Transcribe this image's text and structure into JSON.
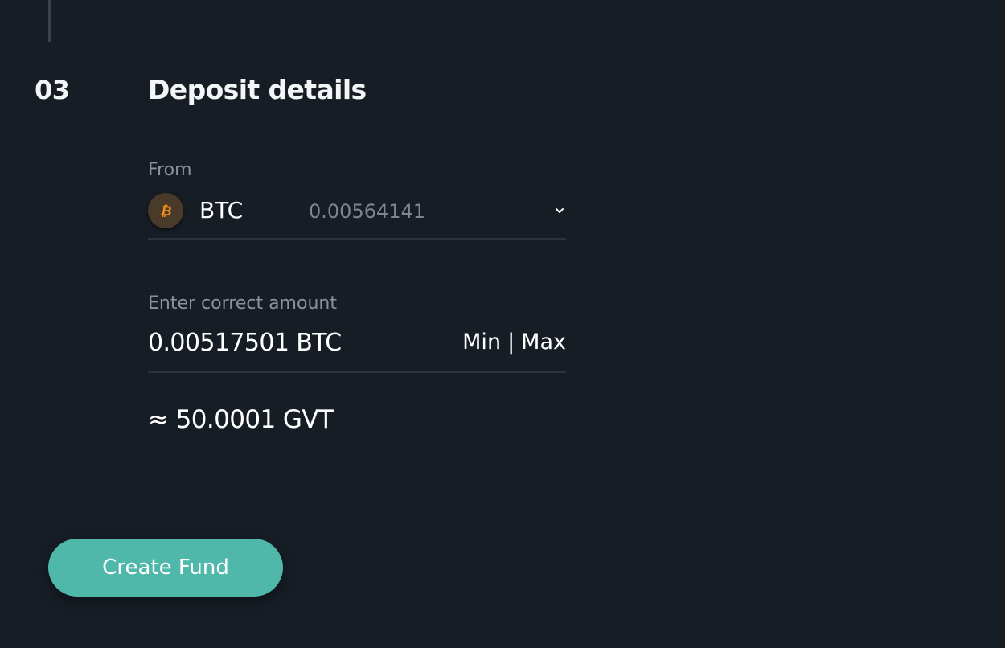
{
  "step": {
    "number": "03",
    "title": "Deposit details"
  },
  "from": {
    "label": "From",
    "currency": "BTC",
    "balance": "0.00564141",
    "coin_icon": "bitcoin-icon",
    "dropdown_icon": "chevron-down-icon"
  },
  "amount": {
    "label": "Enter correct amount",
    "value": "0.00517501 BTC",
    "min_label": "Min",
    "separator": "|",
    "max_label": "Max"
  },
  "conversion": {
    "text": "≈ 50.0001 GVT"
  },
  "actions": {
    "create_label": "Create Fund"
  },
  "colors": {
    "background": "#171d25",
    "accent": "#4fb8aa",
    "bitcoin": "#f7931a"
  }
}
